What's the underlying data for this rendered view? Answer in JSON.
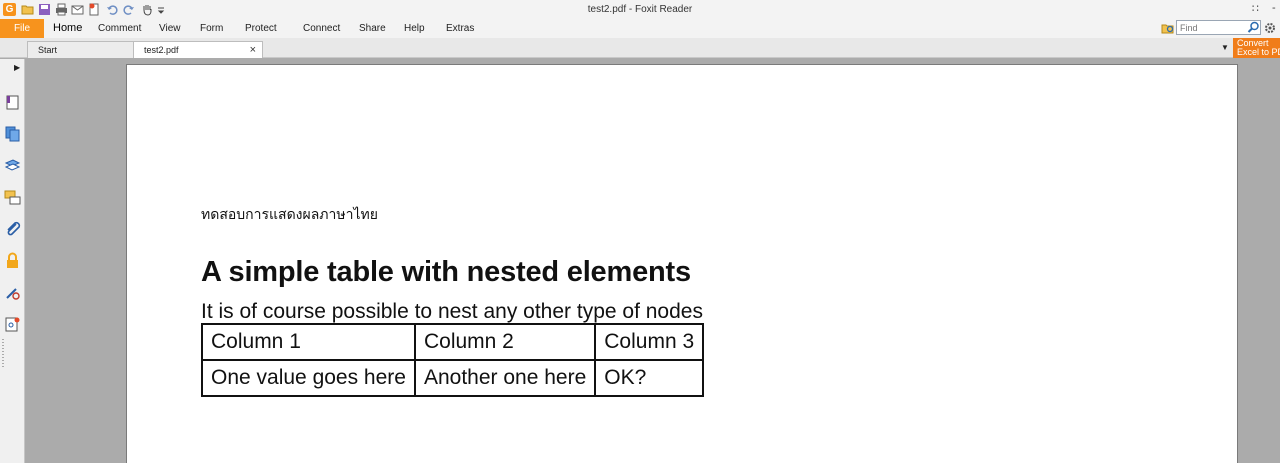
{
  "window": {
    "title": "test2.pdf - Foxit Reader",
    "app_logo": "G"
  },
  "quick_access": [
    "open-icon",
    "save-icon",
    "print-icon",
    "email-icon",
    "new-icon",
    "undo-icon",
    "redo-icon",
    "hand-tool-icon",
    "customize-icon"
  ],
  "menu": {
    "file": "File",
    "items": [
      "Home",
      "Comment",
      "View",
      "Form",
      "Protect",
      "Connect",
      "Share",
      "Help",
      "Extras"
    ],
    "active": "Home"
  },
  "search": {
    "placeholder": "Find"
  },
  "tabs": [
    {
      "label": "Start",
      "active": false
    },
    {
      "label": "test2.pdf",
      "active": true,
      "close": "×"
    }
  ],
  "convert_button": {
    "line1": "Convert",
    "line2": "Excel to PDF"
  },
  "sidebar": {
    "icons": [
      "bookmark-icon",
      "pages-icon",
      "layers-icon",
      "comments-icon",
      "attachments-icon",
      "security-icon",
      "signature-icon",
      "certificate-icon"
    ]
  },
  "document": {
    "thai_line": "ทดสอบการแสดงผลภาษาไทย",
    "heading": "A simple table with nested elements",
    "subtext": "It is of course possible to nest any other type of nodes",
    "table": {
      "rows": [
        [
          "Column 1",
          "Column 2",
          "Column 3"
        ],
        [
          "One value goes here",
          "Another one here",
          "OK?"
        ]
      ]
    }
  },
  "colors": {
    "accent": "#f7931d",
    "convert": "#f07d1a",
    "viewport_bg": "#ababab"
  }
}
